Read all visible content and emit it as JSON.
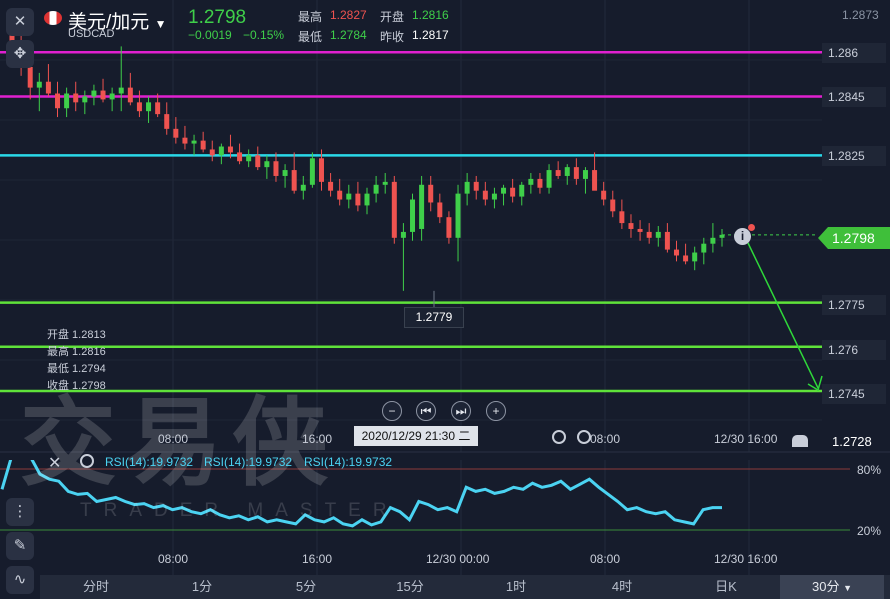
{
  "header": {
    "pair_name": "美元/加元",
    "symbol": "USDCAD",
    "price": "1.2798",
    "change": "−0.0019",
    "change_pct": "−0.15%",
    "high_label": "最高",
    "high_value": "1.2827",
    "open_label": "开盘",
    "open_value": "1.2816",
    "low_label": "最低",
    "low_value": "1.2784",
    "prev_close_label": "昨收",
    "prev_close_value": "1.2817"
  },
  "price_axis": {
    "top_tick": "1.2873",
    "bottom_tick": "1.2728",
    "levels": [
      {
        "value": "1.286",
        "color": "#e020d0"
      },
      {
        "value": "1.2845",
        "color": "#e020d0"
      },
      {
        "value": "1.2825",
        "color": "#2ad8e8"
      },
      {
        "value": "1.2775",
        "color": "#5fe23a"
      },
      {
        "value": "1.276",
        "color": "#5fe23a"
      },
      {
        "value": "1.2745",
        "color": "#5fe23a"
      }
    ],
    "current": "1.2798"
  },
  "low_marker": "1.2779",
  "ohlc_panel": {
    "open": "开盘 1.2813",
    "high": "最高 1.2816",
    "low": "最低 1.2794",
    "close": "收盘 1.2798"
  },
  "time_axis": [
    "08:00",
    "16:00",
    "08:00",
    "12/30 16:00"
  ],
  "crosshair_time": "2020/12/29 21:30 二",
  "rsi": {
    "labels": [
      "RSI(14):19.9732",
      "RSI(14):19.9732",
      "RSI(14):19.9732"
    ],
    "level_high": "80%",
    "level_low": "20%",
    "time_axis": [
      "08:00",
      "16:00",
      "12/30 00:00",
      "08:00",
      "12/30 16:00"
    ]
  },
  "watermark": {
    "text": "交易侠",
    "sub": "TRADER MASTER"
  },
  "tabs": [
    "分时",
    "1分",
    "5分",
    "15分",
    "1时",
    "4时",
    "日K",
    "30分"
  ],
  "active_tab": "30分",
  "colors": {
    "up": "#3fcf4a",
    "down": "#ef5350",
    "background": "#161c2c",
    "rsi": "#4bd3f2"
  },
  "icons": [
    "close-icon",
    "crosshair-icon",
    "chevron-down-icon",
    "info-icon",
    "eye-icon",
    "drawing-icon",
    "pencil-icon",
    "indicator-icon",
    "lock-icon",
    "zoom-out-icon",
    "step-back-icon",
    "step-forward-icon",
    "zoom-in-icon"
  ]
}
